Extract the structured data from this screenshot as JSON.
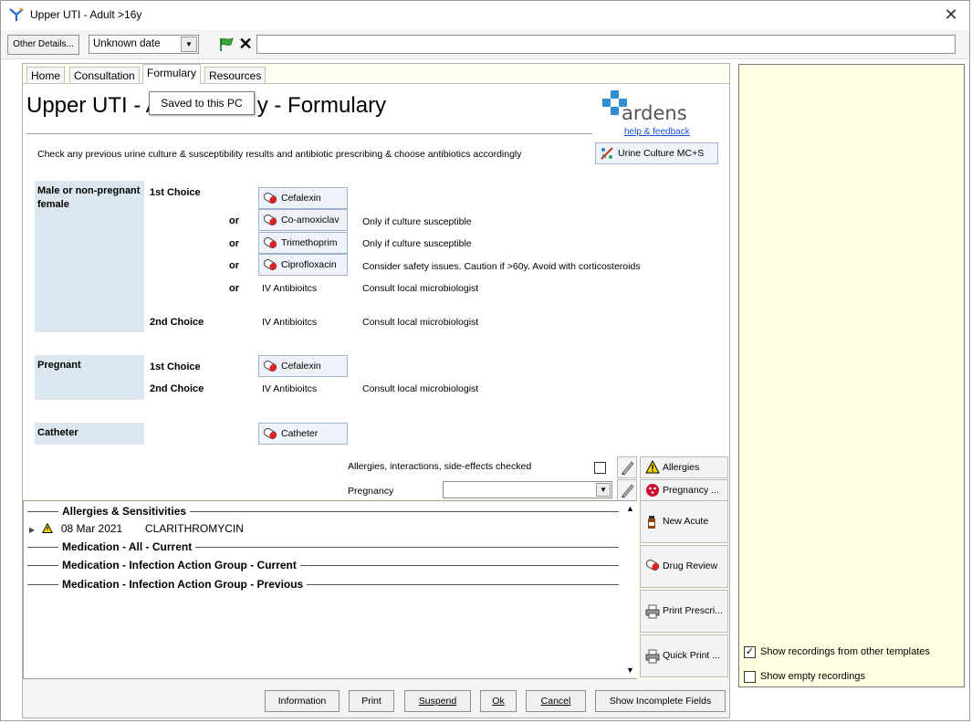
{
  "window": {
    "title": "Upper UTI - Adult >16y"
  },
  "toolbar": {
    "other_details": "Other Details...",
    "date_value": "Unknown date",
    "free_text": ""
  },
  "tabs": [
    "Home",
    "Consultation",
    "Formulary",
    "Resources"
  ],
  "active_tab": "Formulary",
  "tooltip": "Saved to this PC",
  "page": {
    "title_left": "Upper UTI - Ac",
    "title_right": "y - Formulary",
    "logo_word": "ardens",
    "help_link": "help & feedback",
    "instruction": "Check any previous urine culture & susceptibility results and antibiotic prescribing & choose antibiotics accordingly",
    "culture_button": "Urine Culture MC+S"
  },
  "groups": {
    "male": "Male or non-pregnant female",
    "pregnant": "Pregnant",
    "catheter": "Catheter"
  },
  "labels": {
    "first_choice": "1st Choice",
    "second_choice": "2nd Choice",
    "or": "or"
  },
  "drugs": {
    "cefalexin": "Cefalexin",
    "coamoxiclav": "Co-amoxiclav",
    "trimethoprim": "Trimethoprim",
    "ciprofloxacin": "Ciprofloxacin",
    "iv": "IV Antibioitcs",
    "catheter": "Catheter"
  },
  "notes": {
    "culture": "Only if culture susceptible",
    "cipro": "Consider safety issues. Caution if >60y. Avoid with corticosteroids",
    "consult": "Consult local microbiologist"
  },
  "checks": {
    "allergies_checked": "Allergies, interactions, side-effects checked",
    "pregnancy": "Pregnancy",
    "pregnancy_value": ""
  },
  "side_buttons": {
    "allergies": "Allergies",
    "pregnancy": "Pregnancy ..."
  },
  "list": {
    "sections": [
      "Allergies & Sensitivities",
      "Medication - All - Current",
      "Medication - Infection Action Group - Current",
      "Medication - Infection Action Group - Previous"
    ],
    "allergy": {
      "date": "08 Mar 2021",
      "name": "CLARITHROMYCIN"
    }
  },
  "actions": {
    "new_acute": "New Acute",
    "drug_review": "Drug Review",
    "print_prescri": "Print Prescri...",
    "quick_print": "Quick Print ..."
  },
  "footer": {
    "information": "Information",
    "print": "Print",
    "suspend": "Suspend",
    "ok": "Ok",
    "cancel": "Cancel",
    "show_incomplete": "Show Incomplete Fields"
  },
  "right_panel": {
    "show_other": "Show recordings from other templates",
    "show_other_checked": true,
    "show_empty": "Show empty recordings",
    "show_empty_checked": false
  }
}
